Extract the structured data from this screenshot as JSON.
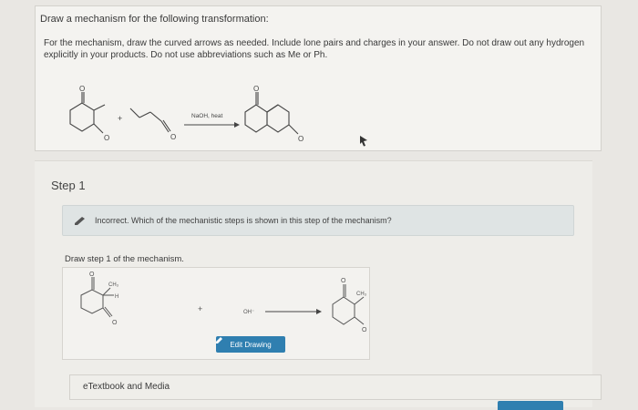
{
  "question": {
    "title": "Draw a mechanism for the following transformation:",
    "instructions": "For the mechanism, draw the curved arrows as needed. Include lone pairs and charges in your answer. Do not draw out any hydrogen explicitly in your products. Do not use abbreviations such as Me or Ph.",
    "reaction": {
      "plus": "+",
      "conditions": "NaOH, heat",
      "o_label": "O"
    }
  },
  "step": {
    "label": "Step 1",
    "feedback": "Incorrect. Which of the mechanistic steps is shown in this step of the mechanism?",
    "draw_prompt": "Draw step 1 of the mechanism.",
    "structure_labels": {
      "ch3": "CH₃",
      "h": "H",
      "o": "O",
      "plus": "+",
      "hydroxide": "OH⁻"
    },
    "edit_button": "Edit Drawing"
  },
  "etextbook": {
    "label": "eTextbook and Media"
  },
  "colors": {
    "primary_button": "#2f7fb0",
    "feedback_bg": "#dfe4e4"
  }
}
